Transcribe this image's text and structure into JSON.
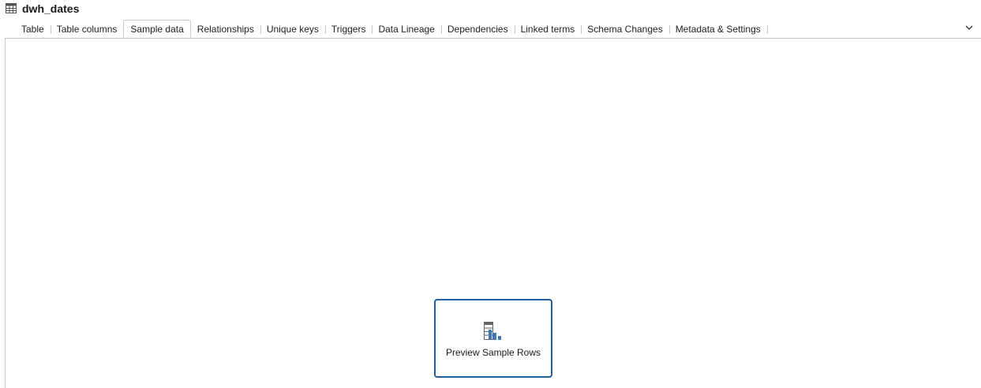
{
  "header": {
    "title": "dwh_dates",
    "icon": "table-grid-icon"
  },
  "tabs": [
    {
      "label": "Table",
      "active": false
    },
    {
      "label": "Table columns",
      "active": false
    },
    {
      "label": "Sample data",
      "active": true
    },
    {
      "label": "Relationships",
      "active": false
    },
    {
      "label": "Unique keys",
      "active": false
    },
    {
      "label": "Triggers",
      "active": false
    },
    {
      "label": "Data Lineage",
      "active": false
    },
    {
      "label": "Dependencies",
      "active": false
    },
    {
      "label": "Linked terms",
      "active": false
    },
    {
      "label": "Schema Changes",
      "active": false
    },
    {
      "label": "Metadata & Settings",
      "active": false
    }
  ],
  "overflow_menu_icon": "chevron-down-icon",
  "preview": {
    "label": "Preview Sample Rows",
    "icon": "table-chart-icon",
    "border_color": "#1f5fa8",
    "icon_color": "#3b78c2"
  }
}
